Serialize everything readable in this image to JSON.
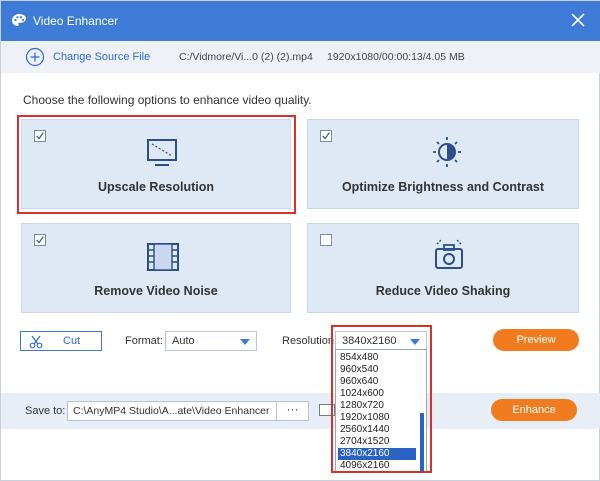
{
  "window": {
    "title": "Video Enhancer",
    "close_icon": "close-icon",
    "app_icon": "palette-icon"
  },
  "source": {
    "change_label": "Change Source File",
    "file": "C:/Vidmore/Vi...0 (2) (2).mp4",
    "info": "1920x1080/00:00:13/4.05 MB"
  },
  "instruction": "Choose the following options to enhance video quality.",
  "options": [
    {
      "label": "Upscale Resolution",
      "checked": true,
      "icon": "monitor-icon"
    },
    {
      "label": "Optimize Brightness and Contrast",
      "checked": true,
      "icon": "brightness-icon"
    },
    {
      "label": "Remove Video Noise",
      "checked": true,
      "icon": "film-icon"
    },
    {
      "label": "Reduce Video Shaking",
      "checked": false,
      "icon": "camera-shake-icon"
    }
  ],
  "controls": {
    "cut_label": "Cut",
    "format_label": "Format:",
    "format_value": "Auto",
    "resolution_label": "Resolution:",
    "resolution_value": "3840x2160",
    "preview_label": "Preview"
  },
  "resolution_options": [
    "854x480",
    "960x540",
    "960x640",
    "1024x600",
    "1280x720",
    "1920x1080",
    "2560x1440",
    "2704x1520",
    "3840x2160",
    "4096x2160"
  ],
  "save": {
    "label": "Save to:",
    "path": "C:\\AnyMP4 Studio\\A...ate\\Video Enhancer",
    "browse_label": "···",
    "enhance_label": "Enhance"
  },
  "colors": {
    "accent": "#3d7bd6",
    "orange": "#f07c1f",
    "highlight": "#d9302a"
  }
}
